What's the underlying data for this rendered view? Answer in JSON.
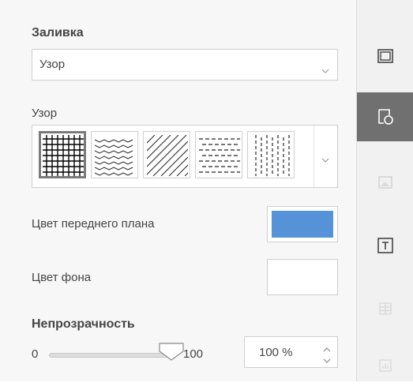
{
  "fill": {
    "title": "Заливка",
    "type_value": "Узор"
  },
  "pattern": {
    "label": "Узор",
    "swatches": [
      "grid",
      "horizontal-dashes",
      "diagonal-lines",
      "horizontal-dashed",
      "vertical-dashes"
    ],
    "selected": "grid"
  },
  "foreground": {
    "label": "Цвет переднего плана",
    "color": "#5592d8"
  },
  "background": {
    "label": "Цвет фона",
    "color": "#ffffff"
  },
  "opacity": {
    "title": "Непрозрачность",
    "min": "0",
    "max": "100",
    "value": 1.0,
    "field_value": "100 %"
  },
  "sidebar": {
    "tabs": [
      {
        "icon": "slide-settings-icon",
        "active": false
      },
      {
        "icon": "shape-settings-icon",
        "active": true
      },
      {
        "icon": "image-settings-icon",
        "active": false,
        "disabled": true
      },
      {
        "icon": "text-settings-icon",
        "active": false
      },
      {
        "icon": "table-settings-icon",
        "active": false,
        "disabled": true
      },
      {
        "icon": "chart-settings-icon",
        "active": false,
        "disabled": true
      }
    ]
  },
  "colors": {
    "accent_active_tab": "#707070",
    "panel_bg": "#f7f7f7"
  }
}
